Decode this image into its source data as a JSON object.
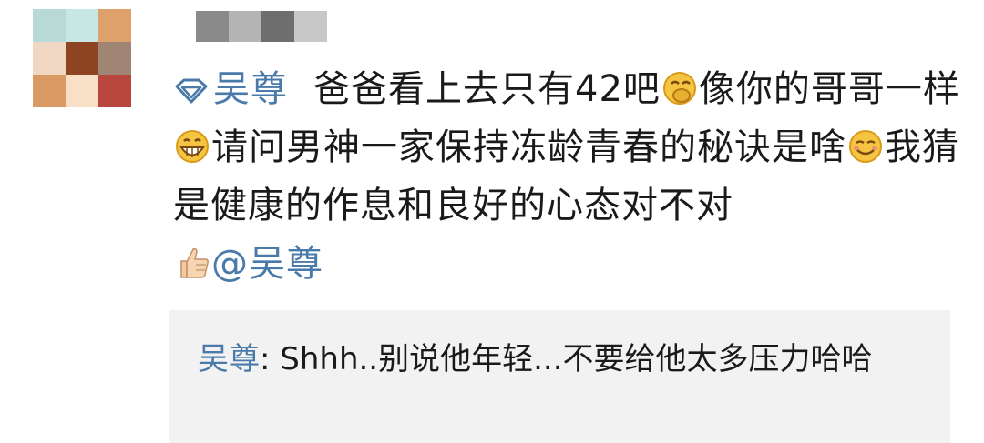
{
  "comment": {
    "author_avatar_pixels": [
      "#b8d9d6",
      "#c8e6e3",
      "#dfa16c",
      "#f0d7c4",
      "#8c4422",
      "#a08575",
      "#d99a63",
      "#f7e0c5",
      "#b8473d"
    ],
    "name_blur_pixels": [
      "#8a8a8a",
      "#b4b4b4",
      "#6e6e6e",
      "#c7c7c7"
    ],
    "mention_name": "吴尊",
    "segment_1": "爸爸看上去只有42吧",
    "segment_2": "像你的哥哥一样",
    "segment_3": "请问男神一家保持冻龄青春的秘诀是啥",
    "segment_4": "我猜是健康的作息和良好的心态对不对",
    "at_mention": "@吴尊",
    "link_color": "#4a7aa9"
  },
  "reply": {
    "author": "吴尊",
    "text": ": Shhh..别说他年轻...不要给他太多压力哈哈"
  }
}
